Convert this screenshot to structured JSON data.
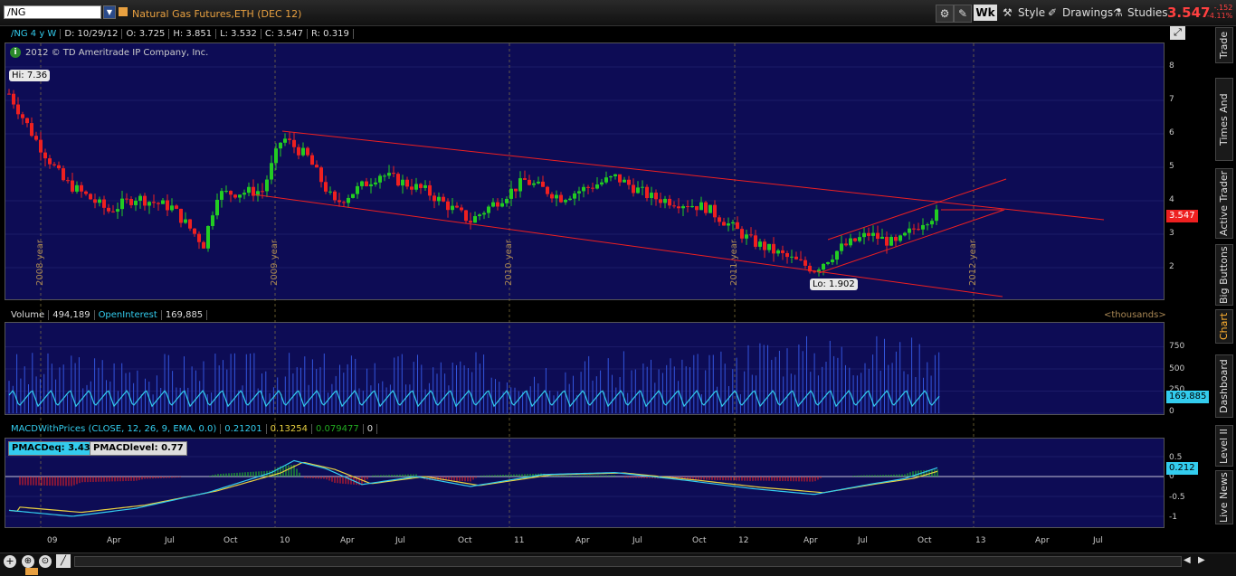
{
  "toolbar": {
    "symbol": "/NG",
    "description": "Natural Gas Futures,ETH (DEC 12)",
    "aggregation_label": "Wk",
    "style_label": "Style",
    "drawings_label": "Drawings",
    "studies_label": "Studies",
    "last_price": "3.547",
    "change_abs": "-.152",
    "change_pct": "-4.11%"
  },
  "price_panel": {
    "header_symbol": "/NG 4 y W",
    "date": "D: 10/29/12",
    "open": "O: 3.725",
    "high": "H: 3.851",
    "low": "L: 3.532",
    "close": "C: 3.547",
    "range": "R: 0.319",
    "copyright": "2012 © TD Ameritrade IP Company, Inc.",
    "hi_flag": "Hi: 7.36",
    "lo_flag": "Lo: 1.902",
    "price_tag": "3.547",
    "y_ticks": [
      "8",
      "7",
      "6",
      "5",
      "4",
      "3",
      "2"
    ],
    "year_labels": [
      "2008 year",
      "2009 year",
      "2010 year",
      "2011 year",
      "2012 year"
    ]
  },
  "volume_panel": {
    "label": "Volume",
    "volume_value": "494,189",
    "oi_label": "OpenInterest",
    "oi_value": "169,885",
    "units": "<thousands>",
    "y_ticks": [
      "750",
      "500",
      "250",
      "0"
    ],
    "oi_tag": "169.885"
  },
  "macd_panel": {
    "label": "MACDWithPrices (CLOSE, 12, 26, 9, EMA, 0.0)",
    "value1": "0.21201",
    "value2": "0.13254",
    "value3": "0.079477",
    "value4": "0",
    "pmac_eq": "PMACDeq: 3.43",
    "pmac_level": "PMACDlevel: 0.77",
    "y_ticks": [
      "0.5",
      "0",
      "-0.5",
      "-1"
    ],
    "tag": "0.212"
  },
  "x_axis": [
    "09",
    "Apr",
    "Jul",
    "Oct",
    "10",
    "Apr",
    "Jul",
    "Oct",
    "11",
    "Apr",
    "Jul",
    "Oct",
    "12",
    "Apr",
    "Jul",
    "Oct",
    "13",
    "Apr",
    "Jul"
  ],
  "side_tabs": [
    "Trade",
    "Times And Sales",
    "Active Trader",
    "Big Buttons",
    "Chart",
    "Dashboard",
    "Level II",
    "Live News"
  ],
  "colors": {
    "up": "#22cc22",
    "down": "#ee2020",
    "channel": "#ee2020",
    "panel_bg": "#0d0c55",
    "volume": "#3355dd",
    "oi": "#33ccee",
    "macd": "#33ccee",
    "signal": "#e8d040"
  },
  "icons": [
    "settings-icon",
    "link-icon",
    "zoom-icon",
    "style-icon",
    "drawings-icon",
    "studies-icon",
    "add-icon",
    "zoom-in-icon",
    "zoom-out-icon"
  ]
}
